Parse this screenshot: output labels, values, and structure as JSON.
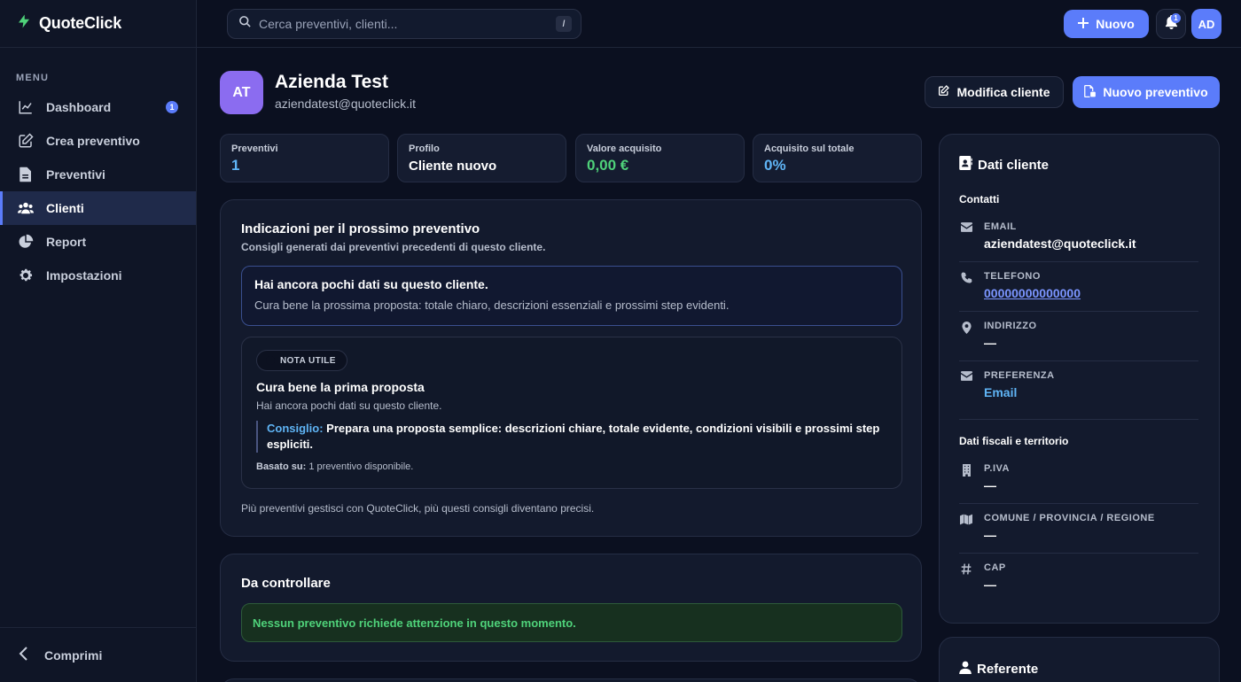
{
  "app": {
    "name": "QuoteClick",
    "brand_color": "#5b7cfa"
  },
  "sidebar": {
    "menu_label": "MENU",
    "items": [
      {
        "label": "Dashboard",
        "icon": "chart-line-icon",
        "badge": "1"
      },
      {
        "label": "Crea preventivo",
        "icon": "edit-icon"
      },
      {
        "label": "Preventivi",
        "icon": "file-icon"
      },
      {
        "label": "Clienti",
        "icon": "users-icon",
        "active": true
      },
      {
        "label": "Report",
        "icon": "pie-chart-icon"
      },
      {
        "label": "Impostazioni",
        "icon": "gear-icon"
      }
    ],
    "collapse_label": "Comprimi"
  },
  "topbar": {
    "search_placeholder": "Cerca preventivi, clienti...",
    "search_shortcut": "/",
    "new_label": "Nuovo",
    "notifications_count": "1",
    "user_initials": "AD"
  },
  "client": {
    "initials": "AT",
    "name": "Azienda Test",
    "email": "aziendatest@quoteclick.it",
    "edit_label": "Modifica cliente",
    "new_quote_label": "Nuovo preventivo"
  },
  "stats": [
    {
      "label": "Preventivi",
      "value": "1",
      "color": "#5fb4f5"
    },
    {
      "label": "Profilo",
      "value": "Cliente nuovo",
      "color": "#ffffff"
    },
    {
      "label": "Valore acquisito",
      "value": "0,00 €",
      "color": "#4fd27a"
    },
    {
      "label": "Acquisito sul totale",
      "value": "0%",
      "color": "#5fb4f5"
    }
  ],
  "hints": {
    "title": "Indicazioni per il prossimo preventivo",
    "subtitle": "Consigli generati dai preventivi precedenti di questo cliente.",
    "alert_title": "Hai ancora pochi dati su questo cliente.",
    "alert_text": "Cura bene la prossima proposta: totale chiaro, descrizioni essenziali e prossimi step evidenti.",
    "note_pill": "NOTA UTILE",
    "note_title": "Cura bene la prima proposta",
    "note_text": "Hai ancora pochi dati su questo cliente.",
    "tip_label": "Consiglio:",
    "tip_text": "Prepara una proposta semplice: descrizioni chiare, totale evidente, condizioni visibili e prossimi step espliciti.",
    "based_label": "Basato su:",
    "based_text": "1 preventivo disponibile.",
    "footer": "Più preventivi gestisci con QuoteClick, più questi consigli diventano precisi."
  },
  "check": {
    "title": "Da controllare",
    "ok_text": "Nessun preventivo richiede attenzione in questo momento."
  },
  "details": {
    "title": "Dati cliente",
    "contacts_label": "Contatti",
    "rows": [
      {
        "label": "EMAIL",
        "value": "aziendatest@quoteclick.it",
        "icon": "mail-icon"
      },
      {
        "label": "TELEFONO",
        "value": "00000000000000",
        "icon": "phone-icon"
      },
      {
        "label": "INDIRIZZO",
        "value": "—",
        "icon": "pin-icon"
      },
      {
        "label": "PREFERENZA",
        "value": "Email",
        "icon": "mail-icon"
      }
    ],
    "fiscal_label": "Dati fiscali e territorio",
    "fiscal_rows": [
      {
        "label": "P.IVA",
        "value": "—",
        "icon": "building-icon"
      },
      {
        "label": "COMUNE / PROVINCIA / REGIONE",
        "value": "—",
        "icon": "map-icon"
      },
      {
        "label": "CAP",
        "value": "—",
        "icon": "hash-icon"
      }
    ]
  },
  "referent": {
    "title": "Referente"
  }
}
